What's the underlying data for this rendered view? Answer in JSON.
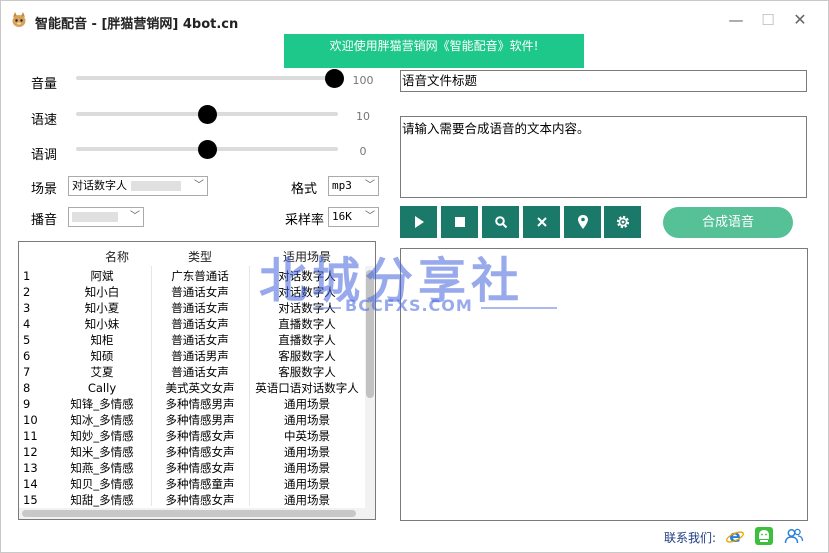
{
  "window": {
    "title": "智能配音 - [胖猫营销网] 4bot.cn",
    "min_glyph": "—",
    "max_glyph": "☐",
    "close_glyph": "✕"
  },
  "banner": "欢迎使用胖猫营销网《智能配音》软件!",
  "controls": {
    "volume": {
      "label": "音量",
      "value": "100",
      "level": 100,
      "max": 100
    },
    "speed": {
      "label": "语速",
      "value": "10",
      "level": 0.5
    },
    "pitch": {
      "label": "语调",
      "value": "0",
      "level": 0.5
    },
    "scene": {
      "label": "场景",
      "selected": "对话数字人"
    },
    "format": {
      "label": "格式",
      "selected": "mp3"
    },
    "voice": {
      "label": "播音",
      "selected": ""
    },
    "sample_rate": {
      "label": "采样率",
      "selected": "16K"
    }
  },
  "table": {
    "headers": [
      "名称",
      "类型",
      "适用场景"
    ],
    "rows": [
      [
        "1",
        "阿斌",
        "广东普通话",
        "对话数字人"
      ],
      [
        "2",
        "知小白",
        "普通话女声",
        "对话数字人"
      ],
      [
        "3",
        "知小夏",
        "普通话女声",
        "对话数字人"
      ],
      [
        "4",
        "知小妹",
        "普通话女声",
        "直播数字人"
      ],
      [
        "5",
        "知柜",
        "普通话女声",
        "直播数字人"
      ],
      [
        "6",
        "知硕",
        "普通话男声",
        "客服数字人"
      ],
      [
        "7",
        "艾夏",
        "普通话女声",
        "客服数字人"
      ],
      [
        "8",
        "Cally",
        "美式英文女声",
        "英语口语对话数字人"
      ],
      [
        "9",
        "知锋_多情感",
        "多种情感男声",
        "通用场景"
      ],
      [
        "10",
        "知冰_多情感",
        "多种情感男声",
        "通用场景"
      ],
      [
        "11",
        "知妙_多情感",
        "多种情感女声",
        "中英场景"
      ],
      [
        "12",
        "知米_多情感",
        "多种情感女声",
        "通用场景"
      ],
      [
        "13",
        "知燕_多情感",
        "多种情感女声",
        "通用场景"
      ],
      [
        "14",
        "知贝_多情感",
        "多种情感童声",
        "通用场景"
      ],
      [
        "15",
        "知甜_多情感",
        "多种情感女声",
        "通用场景"
      ]
    ]
  },
  "title_field": {
    "value": "语音文件标题"
  },
  "text_field": {
    "value": "请输入需要合成语音的文本内容。"
  },
  "toolbar": {
    "color": "#1a7968",
    "icons": [
      "play-icon",
      "stop-icon",
      "search-icon",
      "close-icon",
      "location-pin-icon",
      "gear-icon"
    ]
  },
  "synthesize_label": "合成语音",
  "synthesize_color": "#56c196",
  "banner_color": "#1ec88a",
  "watermark": {
    "main": "北城分享社",
    "sub": "BCCFXS.COM"
  },
  "footer": {
    "contact_label": "联系我们:"
  }
}
